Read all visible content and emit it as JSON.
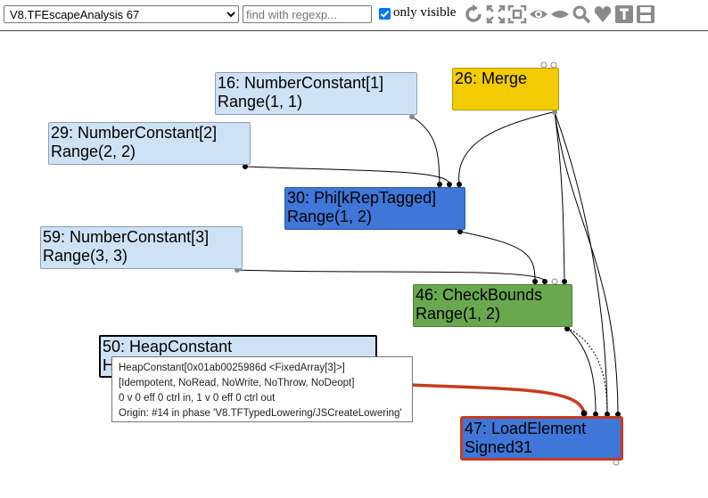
{
  "toolbar": {
    "phase_selected": "V8.TFEscapeAnalysis 67",
    "search_placeholder": "find with regexp...",
    "only_visible_label": "only visible",
    "only_visible_checked": true,
    "icons": [
      "layout-icon",
      "fit-all-icon",
      "fit-selection-icon",
      "show-all-icon",
      "hide-unselected-icon",
      "search-icon",
      "heart-icon",
      "types-icon",
      "save-icon"
    ]
  },
  "nodes": {
    "n16": {
      "line1": "16: NumberConstant[1]",
      "line2": "Range(1, 1)"
    },
    "n26": {
      "line1": "26: Merge"
    },
    "n29": {
      "line1": "29: NumberConstant[2]",
      "line2": "Range(2, 2)"
    },
    "n30": {
      "line1": "30: Phi[kRepTagged]",
      "line2": "Range(1, 2)"
    },
    "n59": {
      "line1": "59: NumberConstant[3]",
      "line2": "Range(3, 3)"
    },
    "n46": {
      "line1": "46: CheckBounds",
      "line2": "Range(1, 2)"
    },
    "n50": {
      "line1": "50: HeapConstant",
      "line2": "H"
    },
    "n47": {
      "line1": "47: LoadElement",
      "line2": "Signed31"
    }
  },
  "tooltip": {
    "line1": "HeapConstant[0x01ab0025986d <FixedArray[3]>]",
    "line2": "[Idempotent, NoRead, NoWrite, NoThrow, NoDeopt]",
    "line3": "0 v 0 eff 0 ctrl in, 1 v 0 eff 0 ctrl out",
    "line4": "Origin: #14 in phase 'V8.TFTypedLowering/JSCreateLowering'"
  },
  "colors": {
    "const": "#cfe2f5",
    "phi": "#3f76d8",
    "merge": "#f2cc00",
    "checkbounds": "#6aa84f",
    "selected_edge": "#c93a1c"
  }
}
